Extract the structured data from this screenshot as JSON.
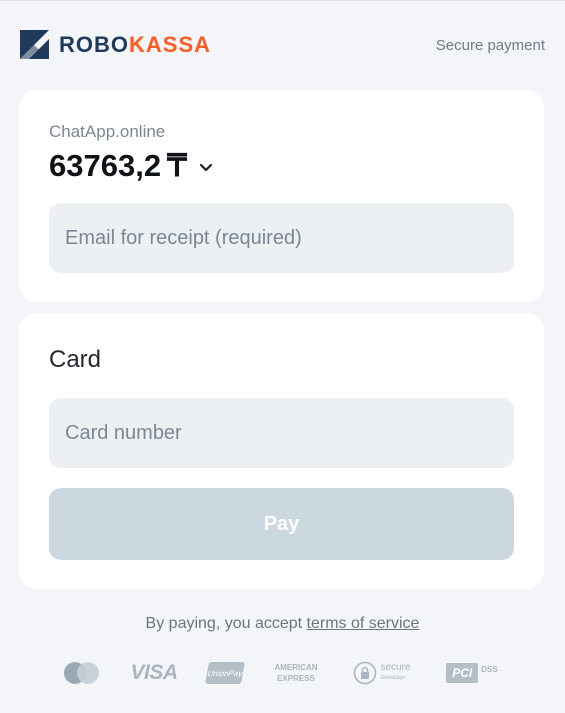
{
  "header": {
    "logo_part1": "ROBO",
    "logo_part2": "KASSA",
    "secure_label": "Secure payment"
  },
  "order": {
    "merchant": "ChatApp.online",
    "amount": "63763,2",
    "currency_symbol": "₸"
  },
  "email": {
    "placeholder": "Email for receipt (required)",
    "value": ""
  },
  "card_section": {
    "title": "Card",
    "card_number_placeholder": "Card number",
    "pay_label": "Pay"
  },
  "terms": {
    "prefix": "By paying, you accept ",
    "link": "terms of service"
  },
  "payment_logos": {
    "visa": "VISA",
    "unionpay": "UnionPay",
    "amex_line1": "AMERICAN",
    "amex_line2": "EXPRESS",
    "secure": "secure",
    "secure_sub": "GlobalSign",
    "pci": "PCI",
    "dss": "DSS"
  },
  "colors": {
    "brand_navy": "#1f3a5a",
    "brand_orange": "#ff5a1f",
    "pay_button_disabled": "#ccd8df"
  }
}
